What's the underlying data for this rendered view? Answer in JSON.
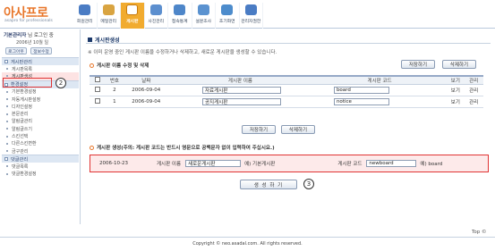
{
  "header": {
    "logo_title": "아사프로",
    "logo_sub": "asapro for professionals",
    "nav": [
      {
        "label": "회원관리",
        "icon": "members-icon",
        "color": "#4a7cc4"
      },
      {
        "label": "메일관리",
        "icon": "mail-icon",
        "color": "#d9a441"
      },
      {
        "label": "게시판",
        "icon": "board-icon",
        "color": "#ffffff",
        "active": true
      },
      {
        "label": "사진관리",
        "icon": "photo-icon",
        "color": "#5c8fcf"
      },
      {
        "label": "접속통계",
        "icon": "stats-icon",
        "color": "#4e86c9"
      },
      {
        "label": "설문조사",
        "icon": "survey-icon",
        "color": "#5a92d0"
      },
      {
        "label": "초기화면",
        "icon": "home-icon",
        "color": "#4d8ccc"
      },
      {
        "label": "관리자권한",
        "icon": "admin-icon",
        "color": "#4a7cc4"
      }
    ]
  },
  "sidebar": {
    "greeting_name": "기본관리자",
    "greeting_rest": " 님 로그인 중",
    "date": "2006년 10월 일",
    "logout_label": "로그아웃",
    "info_label": "정보수정",
    "groups": [
      {
        "label": "게시판관리",
        "items": [
          "게시판목록",
          "게시판생성"
        ]
      },
      {
        "label": "환경설정",
        "items": [
          "기본환경설정",
          "자동게시판설정",
          "디자인설정",
          "본문관리",
          "알림글관리",
          "알림글쓰기",
          "스킨선택",
          "다른스킨변환",
          "금구관리"
        ]
      },
      {
        "label": "댓글관리",
        "items": [
          "댓글목록",
          "댓글환경설정"
        ]
      }
    ],
    "selected_item": "게시판생성"
  },
  "main": {
    "section_title": "게시판생성",
    "info_text": "※ 이미 운영 중인 게시판 이름을 수정하거나 삭제하고, 새로운 게시판을 생성할 수 있습니다.",
    "edit_section_title": "게시판 이름 수정 및 삭제",
    "save_label": "저장하기",
    "delete_label": "삭제하기",
    "table_headers": [
      "",
      "번호",
      "날짜",
      "게시판 이름",
      "게시판 코드",
      "보기",
      "관리"
    ],
    "rows": [
      {
        "no": "2",
        "date": "2006-09-04",
        "name": "자료게시판",
        "code": "board",
        "view": "보기",
        "manage": "관리"
      },
      {
        "no": "1",
        "date": "2006-09-04",
        "name": "공지게시판",
        "code": "notice",
        "view": "보기",
        "manage": "관리"
      }
    ],
    "create_section_title": "게시판 생성",
    "create_note": "(주의: 게시판 코드는 반드시 영문으로 공백문자 없이 입력하여 주십시요.)",
    "create_row": {
      "date": "2006-10-23",
      "name_label": "게시판 이름",
      "name_value": "새로운게시판",
      "name_example": "예) 기본게시판",
      "code_label": "게시판 코드",
      "code_value": "newboard",
      "code_example": "예) board"
    },
    "create_button_label": "생 성 하 기"
  },
  "callouts": {
    "c2": "2",
    "c3": "3"
  },
  "footer": {
    "copyright": "Copyright © neo.asadal.com. All rights reserved.",
    "top_link": "Top ©"
  }
}
